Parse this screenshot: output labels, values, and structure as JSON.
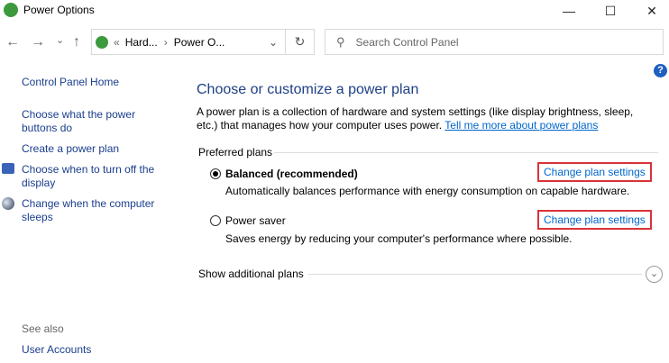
{
  "window": {
    "title": "Power Options",
    "minimize": "—",
    "maximize": "☐",
    "close": "✕"
  },
  "nav": {
    "back": "←",
    "forward": "→",
    "recent": "⌄",
    "up": "↑",
    "breadcrumb": [
      "Hard...",
      "Power O..."
    ],
    "sep_left": "«",
    "sep": "›",
    "dropdown": "⌄",
    "refresh": "↻",
    "search_placeholder": "Search Control Panel",
    "help": "?"
  },
  "sidebar": {
    "home": "Control Panel Home",
    "items": [
      "Choose what the power buttons do",
      "Create a power plan",
      "Choose when to turn off the display",
      "Change when the computer sleeps"
    ],
    "see_also": "See also",
    "see_also_items": [
      "User Accounts"
    ]
  },
  "main": {
    "heading": "Choose or customize a power plan",
    "intro": "A power plan is a collection of hardware and system settings (like display brightness, sleep, etc.) that manages how your computer uses power.",
    "intro_link": "Tell me more about power plans",
    "preferred": "Preferred plans",
    "plans": [
      {
        "name": "Balanced (recommended)",
        "selected": true,
        "desc": "Automatically balances performance with energy consumption on capable hardware.",
        "action": "Change plan settings"
      },
      {
        "name": "Power saver",
        "selected": false,
        "desc": "Saves energy by reducing your computer's performance where possible.",
        "action": "Change plan settings"
      }
    ],
    "additional": "Show additional plans"
  }
}
